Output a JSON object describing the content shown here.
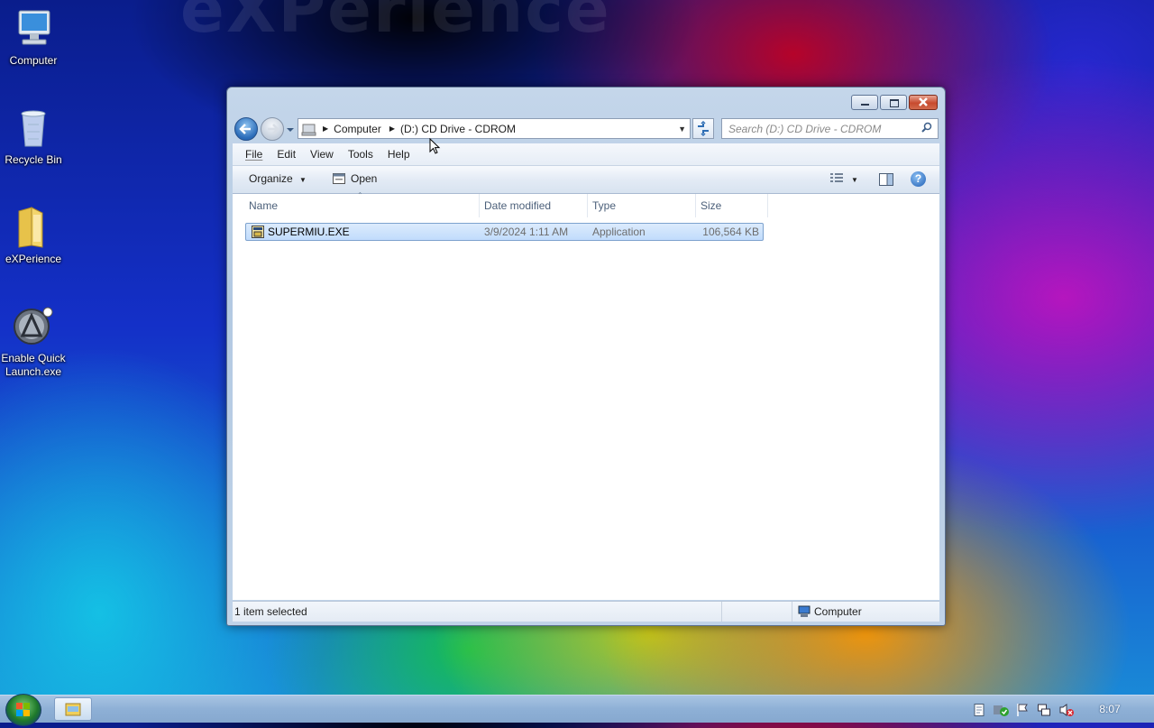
{
  "desktop": {
    "wallpaper_text": "eXPerience",
    "icons": [
      {
        "label": "Computer",
        "icon": "computer-icon"
      },
      {
        "label": "Recycle Bin",
        "icon": "recycle-bin-icon"
      },
      {
        "label": "eXPerience",
        "icon": "folder-icon"
      },
      {
        "label": "Enable Quick Launch.exe",
        "icon": "quick-launch-icon"
      }
    ]
  },
  "window": {
    "breadcrumb": [
      "Computer",
      "(D:) CD Drive - CDROM"
    ],
    "search_placeholder": "Search (D:) CD Drive - CDROM",
    "menu": [
      "File",
      "Edit",
      "View",
      "Tools",
      "Help"
    ],
    "menu_underline": [
      "F",
      "E",
      "V",
      "T",
      "H"
    ],
    "toolbar": {
      "organize": "Organize",
      "open": "Open"
    },
    "columns": [
      "Name",
      "Date modified",
      "Type",
      "Size"
    ],
    "files": [
      {
        "name": "SUPERMIU.EXE",
        "date": "3/9/2024 1:11 AM",
        "type": "Application",
        "size": "106,564 KB",
        "selected": true
      }
    ],
    "status": {
      "left": "1 item selected",
      "right": "Computer"
    }
  },
  "taskbar": {
    "clock": "8:07",
    "tray_icons": [
      "document-icon",
      "security-check-icon",
      "flag-icon",
      "network-icon",
      "volume-muted-icon"
    ]
  },
  "colors": {
    "selection": "#c1dcfc",
    "window_frame": "#b3c9e2",
    "close_button": "#c74a2e"
  }
}
